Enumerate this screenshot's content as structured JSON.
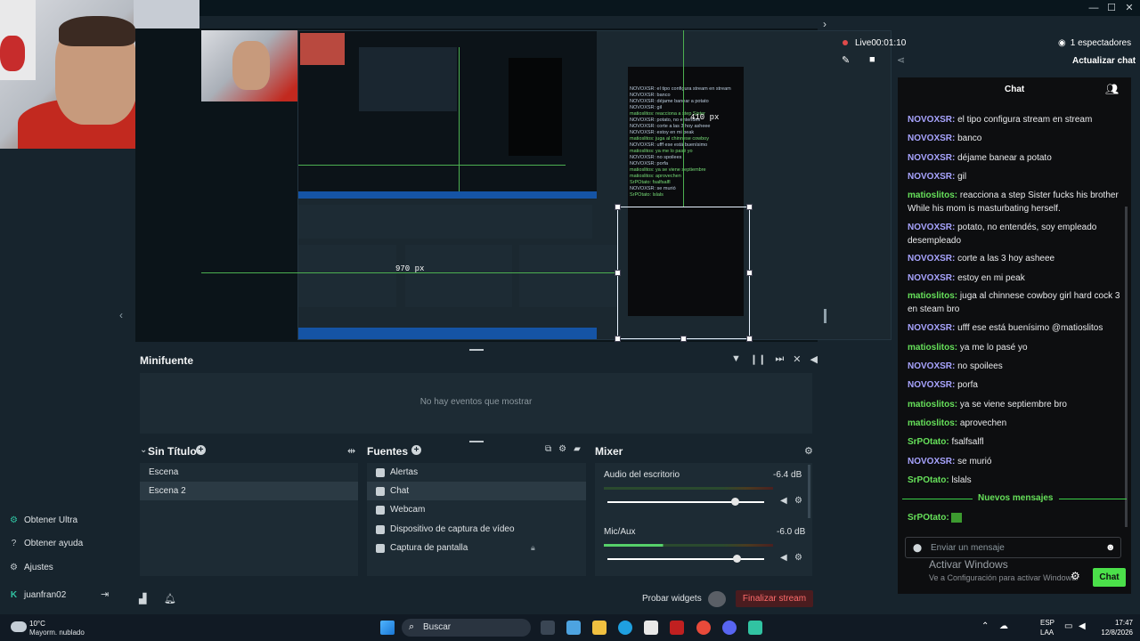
{
  "window": {
    "minimize": "—",
    "maximize": "☐",
    "close": "✕"
  },
  "leftnav": {
    "items": [
      {
        "label": "Obtener Ultra",
        "icon": "ultra-icon"
      },
      {
        "label": "Obtener ayuda",
        "icon": "help-icon"
      },
      {
        "label": "Ajustes",
        "icon": "gear-icon"
      }
    ],
    "user": "juanfran02"
  },
  "preview": {
    "guide_width_label": "970  px",
    "guide_height_label": "410  px"
  },
  "minifuente": {
    "title": "Minifuente",
    "empty": "No hay eventos que mostrar"
  },
  "scenes": {
    "title": "Sin Título",
    "items": [
      "Escena",
      "Escena 2"
    ],
    "selected": 1
  },
  "sources": {
    "title": "Fuentes",
    "items": [
      {
        "label": "Alertas",
        "icon": "bell-icon"
      },
      {
        "label": "Chat",
        "icon": "chat-icon"
      },
      {
        "label": "Webcam",
        "icon": "webcam-icon"
      },
      {
        "label": "Dispositivo de captura de vídeo",
        "icon": "camera-icon"
      },
      {
        "label": "Captura de pantalla",
        "icon": "monitor-icon"
      }
    ],
    "selected": 1
  },
  "mixer": {
    "title": "Mixer",
    "channels": [
      {
        "name": "Audio del escritorio",
        "db": "-6.4 dB",
        "level": 0.0,
        "volume": 0.8
      },
      {
        "name": "Mic/Aux",
        "db": "-6.0 dB",
        "level": 0.3,
        "volume": 0.8
      }
    ]
  },
  "footer": {
    "probar": "Probar widgets",
    "finalizar": "Finalizar stream"
  },
  "live": {
    "status": "Live",
    "time": "00:01:10",
    "viewers": "1 espectadores",
    "refresh": "Actualizar chat"
  },
  "chat": {
    "tab": "Chat",
    "messages": [
      {
        "user": "NOVOXSR",
        "color": "blue",
        "text": "el tipo configura stream en stream"
      },
      {
        "user": "NOVOXSR",
        "color": "blue",
        "text": "banco"
      },
      {
        "user": "NOVOXSR",
        "color": "blue",
        "text": "déjame banear a potato"
      },
      {
        "user": "NOVOXSR",
        "color": "blue",
        "text": "gil"
      },
      {
        "user": "matioslitos",
        "color": "green",
        "text": "reacciona a step Sister fucks his brother While his mom is masturbating herself."
      },
      {
        "user": "NOVOXSR",
        "color": "blue",
        "text": "potato, no entendés, soy empleado desempleado"
      },
      {
        "user": "NOVOXSR",
        "color": "blue",
        "text": "corte a las 3 hoy asheee"
      },
      {
        "user": "NOVOXSR",
        "color": "blue",
        "text": "estoy en mi peak"
      },
      {
        "user": "matioslitos",
        "color": "green",
        "text": "juga al chinnese cowboy girl hard cock 3 en steam bro"
      },
      {
        "user": "NOVOXSR",
        "color": "blue",
        "text": "ufff ese está buenísimo @matioslitos"
      },
      {
        "user": "matioslitos",
        "color": "green",
        "text": "ya me lo pasé yo"
      },
      {
        "user": "NOVOXSR",
        "color": "blue",
        "text": "no spoilees"
      },
      {
        "user": "NOVOXSR",
        "color": "blue",
        "text": "porfa"
      },
      {
        "user": "matioslitos",
        "color": "green",
        "text": "ya se viene septiembre bro"
      },
      {
        "user": "matioslitos",
        "color": "green",
        "text": "aprovechen"
      },
      {
        "user": "SrPOtato",
        "color": "green",
        "text": "fsalfsalfl"
      },
      {
        "user": "NOVOXSR",
        "color": "blue",
        "text": "se murió"
      },
      {
        "user": "SrPOtato",
        "color": "green",
        "text": "lslals"
      }
    ],
    "new_messages": "Nuevos mensajes",
    "last_user": "SrPOtato",
    "placeholder": "Enviar un mensaje",
    "send": "Chat",
    "activate_title": "Activar Windows",
    "activate_sub": "Ve a Configuración para activar Windows."
  },
  "taskbar": {
    "weather_temp": "10°C",
    "weather_desc": "Mayorm. nublado",
    "search": "Buscar",
    "lang1": "ESP",
    "lang2": "LAA",
    "time": "17:47",
    "date": "12/8/2026"
  },
  "colors": {
    "accent": "#31c3a2",
    "green": "#66e05a",
    "blue": "#a8a4ff",
    "danger": "#e04a4a"
  }
}
